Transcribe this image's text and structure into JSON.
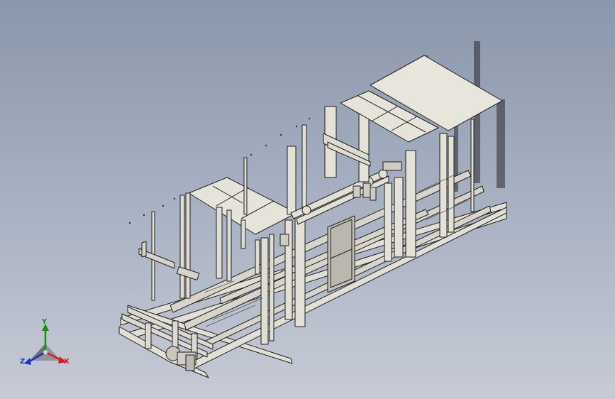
{
  "viewport": {
    "background_top": "#8a96aa",
    "background_bottom": "#c6cbd5",
    "model_color": "#e2e0d6",
    "edge_color": "#1f1f1f"
  },
  "model": {
    "icon": "3d-machine-frame-model"
  },
  "triad": {
    "x_label": "X",
    "y_label": "Y",
    "z_label": "Z",
    "x_color": "#d02020",
    "y_color": "#1a8f1a",
    "z_color": "#2030c0"
  }
}
